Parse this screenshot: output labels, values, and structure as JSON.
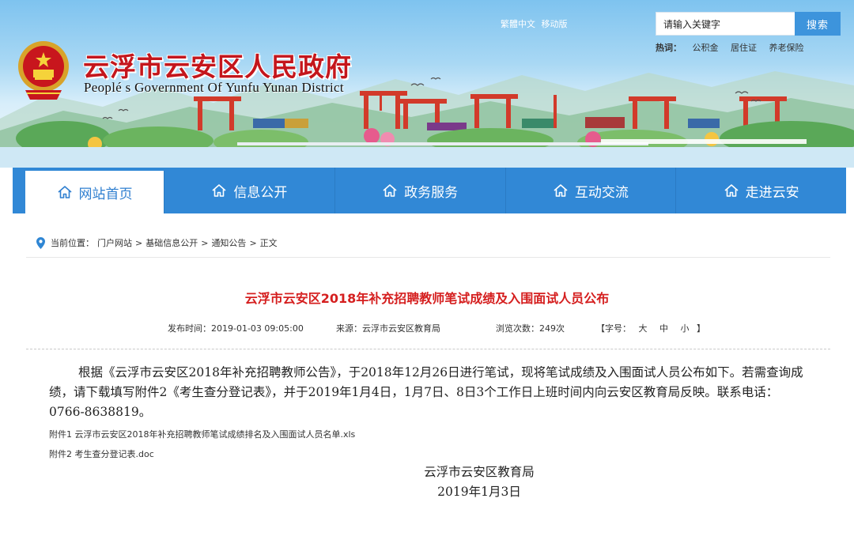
{
  "header": {
    "site_title": "云浮市云安区人民政府",
    "site_subtitle": "Peoplé s Government Of Yunfu Yunan District",
    "top_links": [
      "繁體中文",
      "移动版"
    ],
    "search": {
      "value": "请输入关键字",
      "button": "搜索"
    },
    "hotwords_label": "热词：",
    "hotwords": [
      "公积金",
      "居住证",
      "养老保险"
    ]
  },
  "nav": {
    "items": [
      {
        "label": "网站首页",
        "icon": "home-icon"
      },
      {
        "label": "信息公开",
        "icon": "home-icon"
      },
      {
        "label": "政务服务",
        "icon": "home-icon"
      },
      {
        "label": "互动交流",
        "icon": "home-icon"
      },
      {
        "label": "走进云安",
        "icon": "home-icon"
      }
    ]
  },
  "breadcrumb": {
    "label": "当前位置：",
    "items": [
      "门户网站",
      "基础信息公开",
      "通知公告",
      "正文"
    ],
    "separator": ">"
  },
  "article": {
    "title": "云浮市云安区2018年补充招聘教师笔试成绩及入围面试人员公布",
    "meta": {
      "date": "发布时间：2019-01-03 09:05:00",
      "source": "来源：云浮市云安区教育局",
      "views": "浏览次数：249次",
      "fontsize_label": "【字号：",
      "fontsize_options": [
        "大",
        "中",
        "小"
      ],
      "fontsize_close": "】"
    },
    "body": "根据《云浮市云安区2018年补充招聘教师公告》，于2018年12月26日进行笔试，现将笔试成绩及入围面试人员公布如下。若需查询成绩，请下载填写附件2《考生查分登记表》，并于2019年1月4日，1月7日、8日3个工作日上班时间内向云安区教育局反映。联系电话：0766-8638819。",
    "attachments": [
      "附件1 云浮市云安区2018年补充招聘教师笔试成绩排名及入围面试人员名单.xls",
      "附件2 考生查分登记表.doc"
    ],
    "signature": {
      "org": "云浮市云安区教育局",
      "date": "2019年1月3日"
    }
  },
  "colors": {
    "nav_blue": "#3188d6",
    "title_red": "#c4161c",
    "article_title_red": "#d51f1f",
    "search_blue": "#3d94dc"
  }
}
